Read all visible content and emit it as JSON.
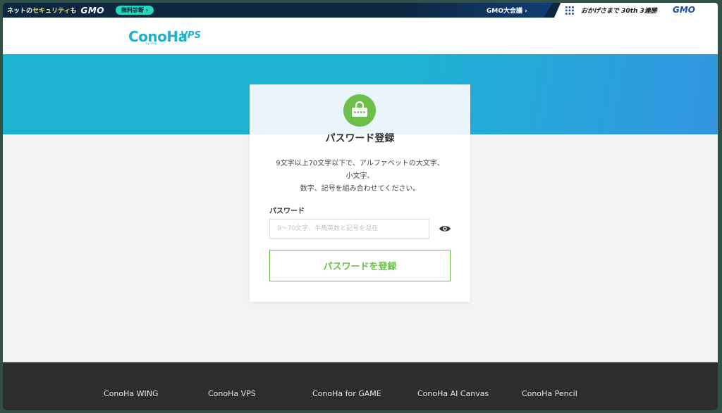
{
  "gmo_bar": {
    "net_prefix": "ネットの",
    "net_highlight": "セキュリティ",
    "net_suffix": "も",
    "gmo_logo": "GMO",
    "diagnosis_button": "無料診断 ›",
    "conference_link": "GMO大会議 ›",
    "okage_text": "おかげさまで 30th 3連勝",
    "gmo_logo_right": "GMO"
  },
  "header": {
    "logo": "ConoHa",
    "logo_sub": "by GMO",
    "product": "VPS"
  },
  "card": {
    "title": "パスワード登録",
    "description_lines": [
      "9文字以上70文字以下で、アルファベットの大文字、",
      "小文字、",
      "数字、記号を組み合わせてください。"
    ],
    "password_label": "パスワード",
    "password_placeholder": "9〜70文字、半角英数と記号を混在",
    "password_value": "",
    "submit_label": "パスワードを登録"
  },
  "footer": {
    "links": [
      "ConoHa WING",
      "ConoHa VPS",
      "ConoHa for GAME",
      "ConoHa AI Canvas",
      "ConoHa Pencil"
    ]
  },
  "colors": {
    "brand_cyan": "#1cb3d3",
    "accent_green": "#6cc04a",
    "footer_bg": "#2c2d2e",
    "gmo_navy": "#0d2740"
  },
  "icons": {
    "lock": "lock-icon",
    "eye": "eye-icon"
  }
}
